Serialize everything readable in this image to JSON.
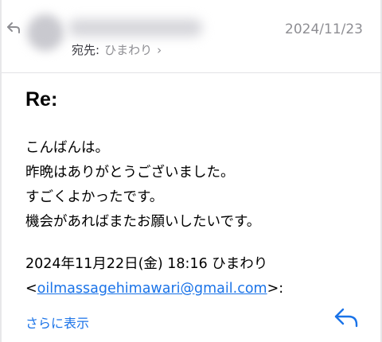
{
  "header": {
    "to_label": "宛先:",
    "to_name": "ひまわり",
    "to_chevron": "›",
    "date": "2024/11/23"
  },
  "message": {
    "subject": "Re:",
    "body_lines": [
      "こんばんは。",
      "昨晩はありがとうございました。",
      "すごくよかったです。",
      "機会があればまたお願いしたいです。"
    ],
    "quote_header": "2024年11月22日(金) 18:16 ひまわり",
    "quote_email_open": "<",
    "quote_email": "oilmassagehimawari@gmail.com",
    "quote_email_close": ">:"
  },
  "footer": {
    "show_more_label": "さらに表示"
  },
  "colors": {
    "accent": "#1a73e8",
    "secondary_text": "#8e8e93",
    "divider": "#e3e3e6"
  },
  "icons": {
    "back": "back-arrow-icon",
    "reply": "reply-arrow-icon"
  }
}
